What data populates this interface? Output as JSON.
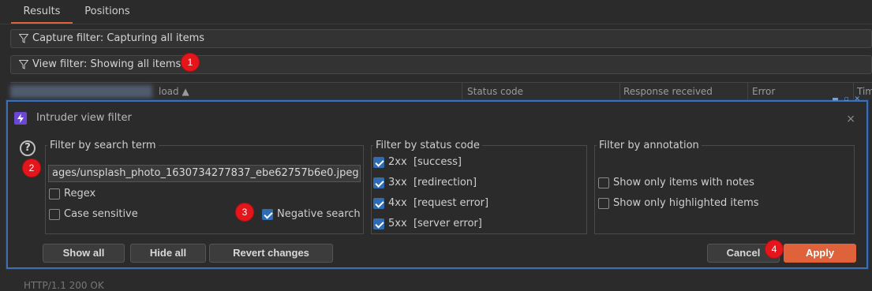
{
  "tabs": [
    {
      "label": "Results"
    },
    {
      "label": "Positions"
    }
  ],
  "filters": {
    "capture": "Capture filter: Capturing all items",
    "view": "View filter: Showing all items"
  },
  "table": {
    "columns": [
      "load ▲",
      "Status code",
      "Response received",
      "Error",
      "Tim"
    ]
  },
  "dialog": {
    "title": "Intruder view filter",
    "close_icon": "×",
    "help_icon": "?",
    "search": {
      "legend": "Filter by search term",
      "value": "ages/unsplash_photo_1630734277837_ebe62757b6e0.jpeg",
      "regex": {
        "label": "Regex",
        "checked": false
      },
      "case_sensitive": {
        "label": "Case sensitive",
        "checked": false
      },
      "negative": {
        "label": "Negative search",
        "checked": true
      }
    },
    "status": {
      "legend": "Filter by status code",
      "items": [
        {
          "code": "2xx",
          "desc": "[success]",
          "checked": true
        },
        {
          "code": "3xx",
          "desc": "[redirection]",
          "checked": true
        },
        {
          "code": "4xx",
          "desc": "[request error]",
          "checked": true
        },
        {
          "code": "5xx",
          "desc": "[server error]",
          "checked": true
        }
      ]
    },
    "annotation": {
      "legend": "Filter by annotation",
      "notes": {
        "label": "Show only items with notes",
        "checked": false
      },
      "highlighted": {
        "label": "Show only highlighted items",
        "checked": false
      }
    },
    "buttons": {
      "show_all": "Show all",
      "hide_all": "Hide all",
      "revert": "Revert changes",
      "cancel": "Cancel",
      "apply": "Apply"
    }
  },
  "badges": [
    "1",
    "2",
    "3",
    "4"
  ],
  "bottom_text": "HTTP/1.1 200 OK",
  "colors": {
    "accent": "#e0623a",
    "dialog_border": "#3f6fb0",
    "badge": "#e5161b",
    "checkbox": "#2e6db4"
  }
}
